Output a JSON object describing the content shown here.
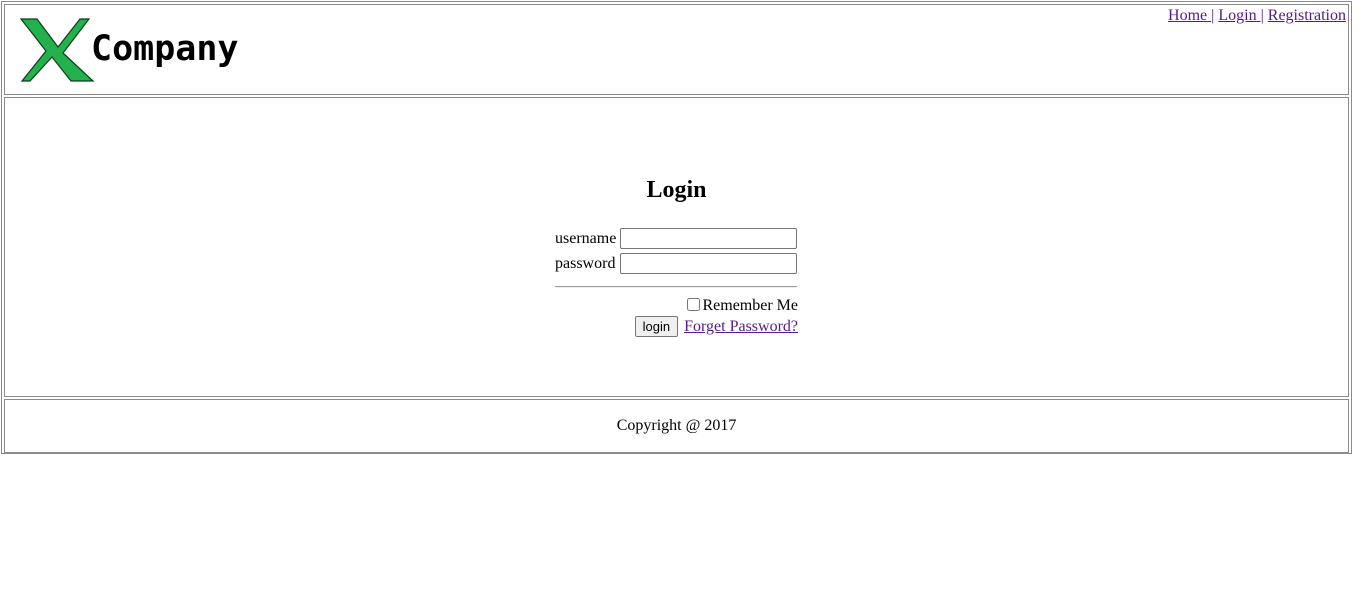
{
  "header": {
    "logo_letter_icon": "green-x-logo-icon",
    "logo_text": "Company",
    "nav": {
      "home": "Home",
      "login": "Login",
      "registration": "Registration",
      "separator": "|"
    }
  },
  "login": {
    "title": "Login",
    "username_label": "username",
    "username_value": "",
    "password_label": "password",
    "password_value": "",
    "remember_label": "Remember Me",
    "remember_checked": false,
    "submit_label": "login",
    "forgot_link": "Forget Password?"
  },
  "footer": {
    "copyright": "Copyright @ 2017"
  },
  "colors": {
    "logo_green": "#22b14c",
    "link_visited": "#551a8b",
    "border_gray": "#8a8a8a"
  }
}
